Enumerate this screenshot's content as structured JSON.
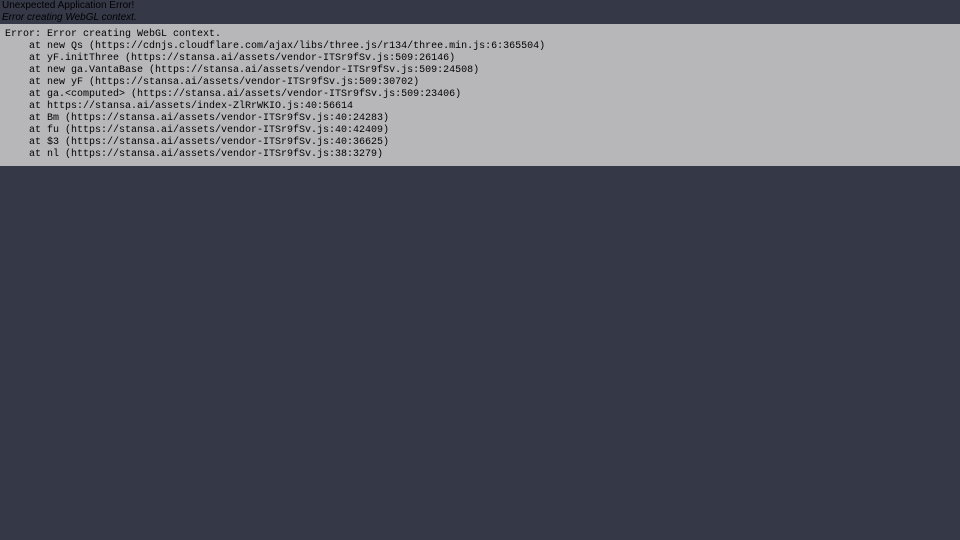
{
  "error": {
    "header": "Unexpected Application Error!",
    "subtitle": "Error creating WebGL context.",
    "stack": "Error: Error creating WebGL context.\n    at new Qs (https://cdnjs.cloudflare.com/ajax/libs/three.js/r134/three.min.js:6:365504)\n    at yF.initThree (https://stansa.ai/assets/vendor-ITSr9fSv.js:509:26146)\n    at new ga.VantaBase (https://stansa.ai/assets/vendor-ITSr9fSv.js:509:24508)\n    at new yF (https://stansa.ai/assets/vendor-ITSr9fSv.js:509:30702)\n    at ga.<computed> (https://stansa.ai/assets/vendor-ITSr9fSv.js:509:23406)\n    at https://stansa.ai/assets/index-ZlRrWKIO.js:40:56614\n    at Bm (https://stansa.ai/assets/vendor-ITSr9fSv.js:40:24283)\n    at fu (https://stansa.ai/assets/vendor-ITSr9fSv.js:40:42409)\n    at $3 (https://stansa.ai/assets/vendor-ITSr9fSv.js:40:36625)\n    at nl (https://stansa.ai/assets/vendor-ITSr9fSv.js:38:3279)"
  }
}
